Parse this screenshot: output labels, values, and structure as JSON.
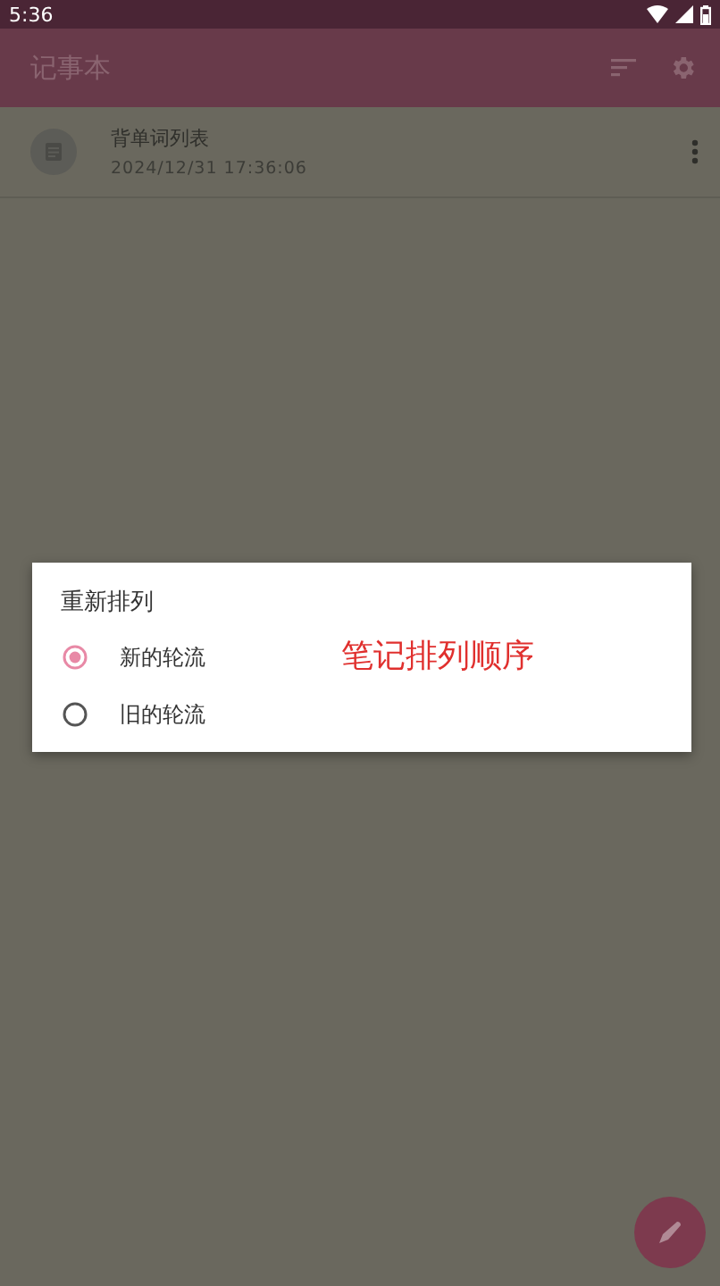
{
  "status_bar": {
    "time": "5:36"
  },
  "app_bar": {
    "title": "记事本"
  },
  "notes": [
    {
      "title": "背单词列表",
      "timestamp": "2024/12/31 17:36:06"
    }
  ],
  "dialog": {
    "title": "重新排列",
    "options": [
      {
        "label": "新的轮流",
        "selected": true
      },
      {
        "label": "旧的轮流",
        "selected": false
      }
    ],
    "annotation": "笔记排列顺序"
  }
}
